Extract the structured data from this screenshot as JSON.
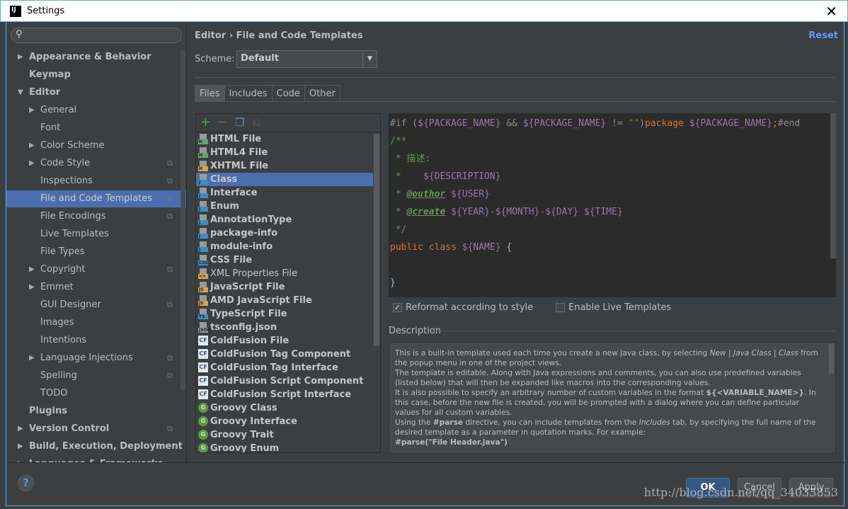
{
  "window": {
    "title": "Settings",
    "close": "✕",
    "logo": "IJ"
  },
  "sidebar": {
    "search_placeholder": "",
    "items": [
      {
        "label": "Appearance & Behavior",
        "level": 0,
        "bold": true,
        "arrow": "▶"
      },
      {
        "label": "Keymap",
        "level": 0,
        "bold": true
      },
      {
        "label": "Editor",
        "level": 0,
        "bold": true,
        "arrow": "▼"
      },
      {
        "label": "General",
        "level": 1,
        "arrow": "▶"
      },
      {
        "label": "Font",
        "level": 1
      },
      {
        "label": "Color Scheme",
        "level": 1,
        "arrow": "▶"
      },
      {
        "label": "Code Style",
        "level": 1,
        "arrow": "▶",
        "copy": true
      },
      {
        "label": "Inspections",
        "level": 1,
        "copy": true
      },
      {
        "label": "File and Code Templates",
        "level": 1,
        "copy": true,
        "selected": true
      },
      {
        "label": "File Encodings",
        "level": 1,
        "copy": true
      },
      {
        "label": "Live Templates",
        "level": 1
      },
      {
        "label": "File Types",
        "level": 1
      },
      {
        "label": "Copyright",
        "level": 1,
        "arrow": "▶",
        "copy": true
      },
      {
        "label": "Emmet",
        "level": 1,
        "arrow": "▶"
      },
      {
        "label": "GUI Designer",
        "level": 1,
        "copy": true
      },
      {
        "label": "Images",
        "level": 1
      },
      {
        "label": "Intentions",
        "level": 1
      },
      {
        "label": "Language Injections",
        "level": 1,
        "arrow": "▶",
        "copy": true
      },
      {
        "label": "Spelling",
        "level": 1,
        "copy": true
      },
      {
        "label": "TODO",
        "level": 1
      },
      {
        "label": "Plugins",
        "level": 0,
        "bold": true
      },
      {
        "label": "Version Control",
        "level": 0,
        "bold": true,
        "arrow": "▶",
        "copy": true
      },
      {
        "label": "Build, Execution, Deployment",
        "level": 0,
        "bold": true,
        "arrow": "▶"
      },
      {
        "label": "Languages & Frameworks",
        "level": 0,
        "bold": true,
        "arrow": "▶"
      }
    ]
  },
  "main": {
    "breadcrumb": "Editor › File and Code Templates",
    "reset": "Reset",
    "scheme_label": "Scheme:",
    "scheme_value": "Default",
    "tabs": [
      "Files",
      "Includes",
      "Code",
      "Other"
    ],
    "active_tab": "Files",
    "toolbar": {
      "add": "+",
      "remove": "−"
    },
    "files": [
      {
        "name": "HTML File",
        "icon": "html",
        "badge": "H",
        "color": "#59a869"
      },
      {
        "name": "HTML4 File",
        "icon": "html",
        "badge": "H",
        "color": "#59a869"
      },
      {
        "name": "XHTML File",
        "icon": "html",
        "badge": "H",
        "color": "#d9a343"
      },
      {
        "name": "Class",
        "icon": "java",
        "badge": "J",
        "color": "#3592c4",
        "selected": true
      },
      {
        "name": "Interface",
        "icon": "java",
        "badge": "J",
        "color": "#3592c4"
      },
      {
        "name": "Enum",
        "icon": "java",
        "badge": "J",
        "color": "#3592c4"
      },
      {
        "name": "AnnotationType",
        "icon": "java",
        "badge": "J",
        "color": "#3592c4"
      },
      {
        "name": "package-info",
        "icon": "java",
        "badge": "J",
        "color": "#3592c4"
      },
      {
        "name": "module-info",
        "icon": "java",
        "badge": "J",
        "color": "#3592c4"
      },
      {
        "name": "CSS File",
        "icon": "css",
        "badge": "CSS",
        "color": "#3592c4"
      },
      {
        "name": "XML Properties File",
        "icon": "xml",
        "badge": "<>",
        "color": "#d9a343",
        "normal": true
      },
      {
        "name": "JavaScript File",
        "icon": "js",
        "badge": "JS",
        "color": "#d9a343"
      },
      {
        "name": "AMD JavaScript File",
        "icon": "js",
        "badge": "JS",
        "color": "#d9a343"
      },
      {
        "name": "TypeScript File",
        "icon": "ts",
        "badge": "TS",
        "color": "#3592c4"
      },
      {
        "name": "tsconfig.json",
        "icon": "json",
        "badge": "JSON",
        "color": "#9a9a9a"
      },
      {
        "name": "ColdFusion File",
        "icon": "coldfusion",
        "badge": "CF"
      },
      {
        "name": "ColdFusion Tag Component",
        "icon": "coldfusion",
        "badge": "CF"
      },
      {
        "name": "ColdFusion Tag Interface",
        "icon": "coldfusion",
        "badge": "CF"
      },
      {
        "name": "ColdFusion Script Component",
        "icon": "coldfusion",
        "badge": "CF"
      },
      {
        "name": "ColdFusion Script Interface",
        "icon": "coldfusion",
        "badge": "CF"
      },
      {
        "name": "Groovy Class",
        "icon": "groovy",
        "badge": "G"
      },
      {
        "name": "Groovy Interface",
        "icon": "groovy",
        "badge": "G"
      },
      {
        "name": "Groovy Trait",
        "icon": "groovy",
        "badge": "G"
      },
      {
        "name": "Groovy Enum",
        "icon": "groovy",
        "badge": "G"
      }
    ],
    "code_lines": [
      [
        [
          "dir",
          "#if ("
        ],
        [
          "var",
          "${PACKAGE_NAME}"
        ],
        [
          "dir",
          " && "
        ],
        [
          "var",
          "${PACKAGE_NAME}"
        ],
        [
          "dir",
          " != "
        ],
        [
          "str",
          "\"\""
        ],
        [
          "dir",
          ")"
        ],
        [
          "kw",
          "package "
        ],
        [
          "var",
          "${PACKAGE_NAME}"
        ],
        [
          "kw",
          ";"
        ],
        [
          "dir",
          "#end"
        ]
      ],
      [
        [
          "cm",
          "/**"
        ]
      ],
      [
        [
          "cm",
          " * 描述:"
        ]
      ],
      [
        [
          "cm",
          " *    "
        ],
        [
          "var",
          "${DESCRIPTION}"
        ]
      ],
      [
        [
          "cm",
          " * "
        ],
        [
          "tag",
          "@outhor"
        ],
        [
          "pl",
          " "
        ],
        [
          "var",
          "${USER}"
        ]
      ],
      [
        [
          "cm",
          " * "
        ],
        [
          "tag",
          "@create"
        ],
        [
          "pl",
          " "
        ],
        [
          "var",
          "${YEAR}"
        ],
        [
          "cm",
          "-"
        ],
        [
          "var",
          "${MONTH}"
        ],
        [
          "cm",
          "-"
        ],
        [
          "var",
          "${DAY}"
        ],
        [
          "pl",
          " "
        ],
        [
          "var",
          "${TIME}"
        ]
      ],
      [
        [
          "cm",
          " */"
        ]
      ],
      [
        [
          "kw",
          "public class "
        ],
        [
          "var",
          "${NAME}"
        ],
        [
          "pl",
          " {"
        ]
      ],
      [
        [
          "pl",
          ""
        ]
      ],
      [
        [
          "pl",
          "}"
        ]
      ]
    ],
    "reformat": {
      "label": "Reformat according to style",
      "checked": true
    },
    "live_templates": {
      "label": "Enable Live Templates",
      "checked": false
    },
    "description_label": "Description",
    "description_html": "This is a built-in template used each time you create a new Java class, by selecting <i>New | Java Class | Class</i> from the popup menu in one of the project views.<br>The template is editable. Along with Java expressions and comments, you can also use predefined variables (listed below) that will then be expanded like macros into the corresponding values.<br>It is also possible to specify an arbitrary number of custom variables in the format <b>${&lt;VARIABLE_NAME&gt;}</b>. In this case, before the new file is created, you will be prompted with a dialog where you can define particular values for all custom variables.<br>Using the <b>#parse</b> directive, you can include templates from the <i>Includes</i> tab, by specifying the full name of the desired template as a parameter in quotation marks. For example:<br><b>#parse(\"File Header.java\")</b>"
  },
  "footer": {
    "help": "?",
    "ok": "OK",
    "cancel": "Cancel",
    "apply": "Apply",
    "watermark": "http://blog.csdn.net/qq_34033853"
  }
}
